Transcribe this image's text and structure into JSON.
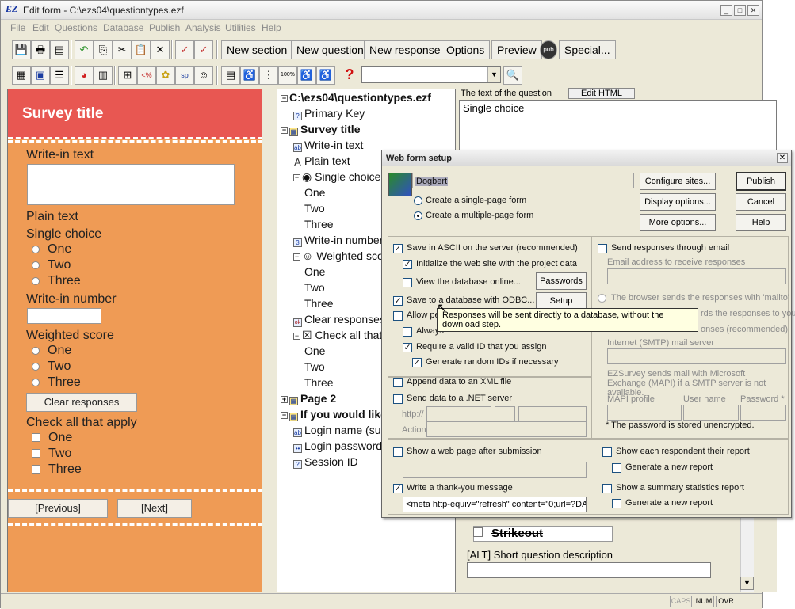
{
  "window": {
    "title": "Edit form - C:\\ezs04\\questiontypes.ezf",
    "app_icon": "EZ"
  },
  "menubar": [
    "File",
    "Edit",
    "Questions",
    "Database",
    "Publish",
    "Analysis",
    "Utilities",
    "Help"
  ],
  "toolbar": {
    "new_section": "New section",
    "new_question": "New question",
    "new_response": "New response",
    "options": "Options",
    "preview": "Preview",
    "special": "Special...",
    "combo_value": ""
  },
  "preview": {
    "survey_title": "Survey title",
    "write_in_text": "Write-in text",
    "plain_text": "Plain text",
    "single_choice": "Single choice",
    "single_choice_options": [
      "One",
      "Two",
      "Three"
    ],
    "write_in_number": "Write-in number",
    "weighted_score": "Weighted score",
    "weighted_options": [
      "One",
      "Two",
      "Three"
    ],
    "clear_responses": "Clear responses",
    "check_all": "Check all that apply",
    "check_options": [
      "One",
      "Two",
      "Three"
    ],
    "previous": "[Previous]",
    "next": "[Next]"
  },
  "tree": {
    "root": "C:\\ezs04\\questiontypes.ezf",
    "primary_key": "Primary Key",
    "survey_title": "Survey title",
    "write_in_text": "Write-in text",
    "plain_text": "Plain text",
    "single_choice": "Single choice",
    "single_opts": [
      "One",
      "Two",
      "Three"
    ],
    "write_in_number": "Write-in number",
    "weighted_score": "Weighted score",
    "weighted_opts": [
      "One",
      "Two",
      "Three"
    ],
    "clear_responses": "Clear responses",
    "check_all": "Check all that a",
    "check_opts": [
      "One",
      "Two",
      "Three"
    ],
    "page2": "Page 2",
    "if_you_would": "If you would like",
    "login_name": "Login name (such",
    "login_password": "Login password",
    "session_id": "Session ID"
  },
  "question_pane": {
    "label": "The text of the question",
    "edit_html": "Edit HTML",
    "text": "Single choice",
    "strikeout": "Strikeout",
    "alt_label": "[ALT] Short question description"
  },
  "dialog": {
    "title": "Web form setup",
    "site_name": "Dogbert",
    "single_page": "Create a single-page form",
    "multi_page": "Create a multiple-page form",
    "configure_sites": "Configure sites...",
    "display_options": "Display options...",
    "more_options": "More options...",
    "publish": "Publish",
    "cancel": "Cancel",
    "help": "Help",
    "save_ascii": "Save in ASCII on the server (recommended)",
    "init_site": "Initialize the web site with the project data",
    "view_db": "View the database online...",
    "passwords": "Passwords",
    "save_odbc": "Save to a database with ODBC...",
    "setup": "Setup",
    "allow_pe": "Allow pe",
    "always": "Always",
    "require_id": "Require a valid ID that you assign",
    "gen_random": "Generate random IDs if necessary",
    "append_xml": "Append data to an XML file",
    "send_net": "Send data to a .NET server",
    "url_prefix": "http://",
    "action": "Action",
    "send_email": "Send responses through email",
    "email_addr": "Email address to receive responses",
    "browser_mailto": "The browser sends the responses with 'mailto'",
    "rds_to_you": "rds the responses to you",
    "onses_rec": "onses (recommended)",
    "smtp": "Internet (SMTP) mail server",
    "exchange_note": "EZSurvey sends mail with Microsoft Exchange (MAPI) if a SMTP server is not available.",
    "mapi_profile": "MAPI profile",
    "user_name": "User name",
    "password_star": "Password *",
    "pw_note": "* The password is stored unencrypted.",
    "show_page": "Show a web page after submission",
    "thankyou": "Write a thank-you message",
    "thankyou_value": "<meta http-equiv=\"refresh\" content=\"0;url=?DA",
    "show_each": "Show each respondent their report",
    "gen_report1": "Generate a new report",
    "show_summary": "Show a summary statistics report",
    "gen_report2": "Generate a new report",
    "tooltip": "Responses will be sent directly to a database, without the download step."
  },
  "statusbar": {
    "caps": "CAPS",
    "num": "NUM",
    "ovr": "OVR"
  }
}
